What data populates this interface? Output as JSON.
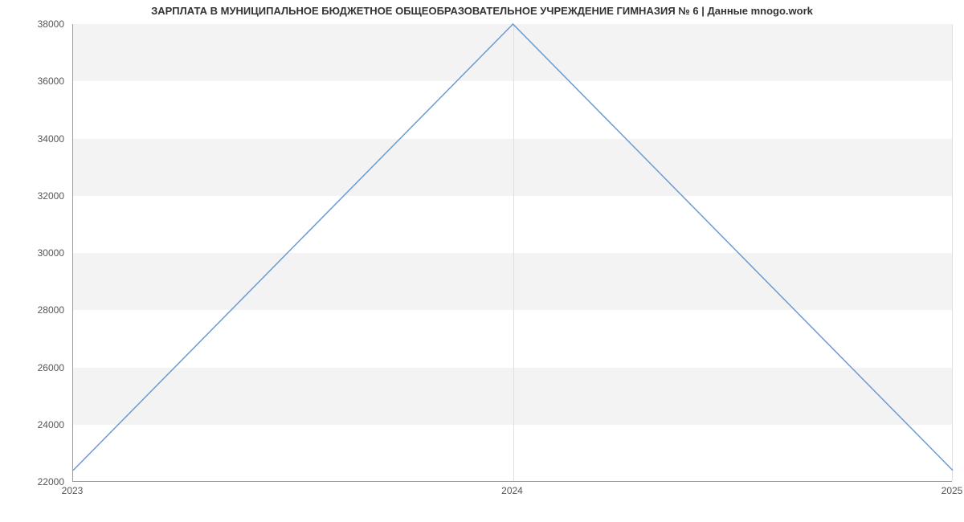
{
  "chart_data": {
    "type": "line",
    "title": "ЗАРПЛАТА В МУНИЦИПАЛЬНОЕ БЮДЖЕТНОЕ ОБЩЕОБРАЗОВАТЕЛЬНОЕ УЧРЕЖДЕНИЕ ГИМНАЗИЯ № 6 | Данные mnogo.work",
    "xlabel": "",
    "ylabel": "",
    "x": [
      2023,
      2024,
      2025
    ],
    "values": [
      22400,
      38000,
      22400
    ],
    "x_ticks": [
      2023,
      2024,
      2025
    ],
    "y_ticks": [
      22000,
      24000,
      26000,
      28000,
      30000,
      32000,
      34000,
      36000,
      38000
    ],
    "xlim": [
      2023,
      2025
    ],
    "ylim": [
      22000,
      38000
    ],
    "line_color": "#6b9bd1",
    "band_color": "#f3f3f3"
  }
}
